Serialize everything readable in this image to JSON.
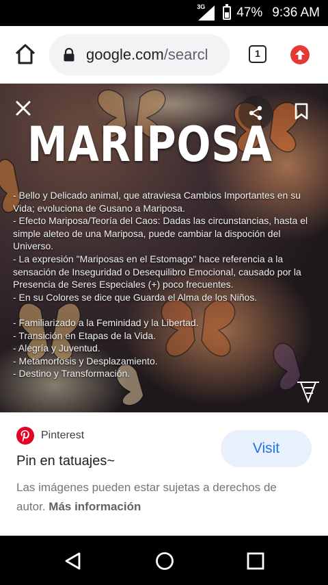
{
  "status_bar": {
    "network": "3G",
    "battery": "47%",
    "battery_level": 0.47,
    "time": "9:36 AM"
  },
  "browser": {
    "url_main": "google.com",
    "url_rest": "/searcl",
    "tab_count": "1",
    "icons": [
      "home-icon",
      "lock-icon",
      "tabs-icon",
      "update-icon"
    ]
  },
  "image": {
    "title": "MARIPOSA",
    "lines": [
      "- Bello y Delicado animal, que atraviesa Cambios Importantes en su Vida; evoluciona de Gusano a Mariposa.",
      "- Efecto Mariposa/Teoría del Caos: Dadas las circunstancias, hasta el simple aleteo de una Mariposa, puede cambiar la dispoción del Universo.",
      "- La expresión \"Mariposas en el Estomago\" hace referencia a la sensación de Inseguridad o Desequilibro Emocional, causado por la Presencia de Seres Especiales (+) poco frecuentes.",
      "- En su Colores se dice que Guarda el Alma de los Niños."
    ],
    "list": [
      "- Familiarizado a la Feminidad y la Libertad.",
      "- Transición en Etapas de la Vida.",
      "- Alegría y Juventud.",
      "- Metamorfosis y Desplazamiento.",
      "- Destino y Transformación."
    ]
  },
  "card": {
    "source": "Pinterest",
    "title": "Pin en tatuajes~",
    "visit_label": "Visit",
    "copyright_text": "Las imágenes pueden estar sujetas a derechos de autor.",
    "more_info": "Más información"
  },
  "colors": {
    "pinterest_red": "#e60023",
    "visit_bg": "#e8f0fe",
    "visit_text": "#1a73e8",
    "update_red": "#e53935"
  }
}
